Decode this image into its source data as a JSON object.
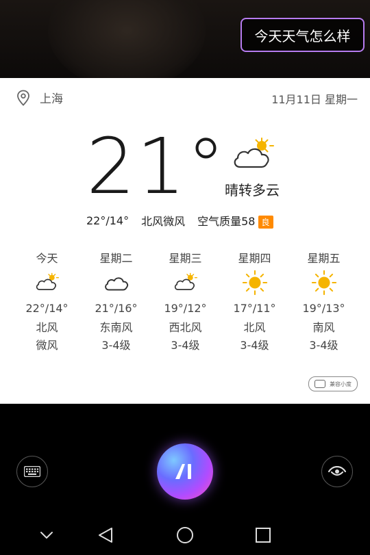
{
  "query": {
    "text": "今天天气怎么样"
  },
  "location": {
    "city": "上海"
  },
  "date": {
    "text": "11月11日 星期一"
  },
  "current": {
    "temperature": "21°",
    "condition": "晴转多云",
    "range": "22°/14°",
    "wind": "北风微风",
    "aqi_label": "空气质量58",
    "aqi_level": "良",
    "icon": "partly-cloudy-icon"
  },
  "forecast": [
    {
      "day": "今天",
      "icon": "partly-cloudy-icon",
      "temp": "22°/14°",
      "wind_dir": "北风",
      "wind_level": "微风"
    },
    {
      "day": "星期二",
      "icon": "cloudy-icon",
      "temp": "21°/16°",
      "wind_dir": "东南风",
      "wind_level": "3-4级"
    },
    {
      "day": "星期三",
      "icon": "partly-cloudy-icon",
      "temp": "19°/12°",
      "wind_dir": "西北风",
      "wind_level": "3-4级"
    },
    {
      "day": "星期四",
      "icon": "sunny-icon",
      "temp": "17°/11°",
      "wind_dir": "北风",
      "wind_level": "3-4级"
    },
    {
      "day": "星期五",
      "icon": "sunny-icon",
      "temp": "19°/13°",
      "wind_dir": "南风",
      "wind_level": "3-4级"
    }
  ],
  "brand": {
    "text": "兼容小度"
  },
  "colors": {
    "aqi_badge": "#ff8a00",
    "sun": "#f5b400",
    "bubble_border": "#b77cf0"
  }
}
